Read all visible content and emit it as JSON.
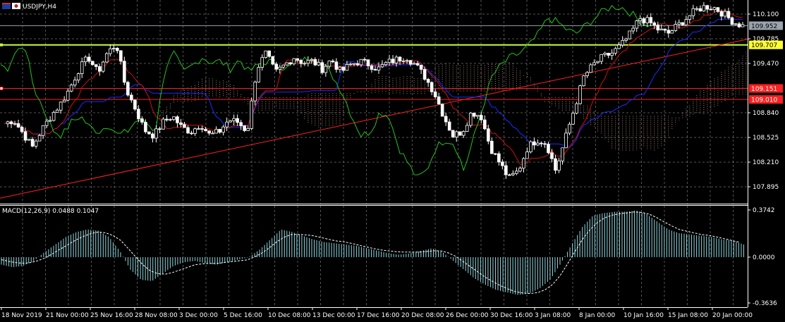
{
  "window": {
    "symbol_title": "USDJPY,H4"
  },
  "colors": {
    "background": "#000000",
    "grid": "#9a9a9a",
    "candle_up": "#ffffff",
    "candle_down": "#ffffff",
    "kijun": "#1a2cff",
    "tenkan": "#d01010",
    "chikou": "#22c41b",
    "cloud_hatch": "#d8a890",
    "hline_red": "#ff1e1e",
    "hline_yellow": "#c6ff3a",
    "trend_red": "#ff2020",
    "macd_hist": "#8fd8e0",
    "macd_signal": "#ffffff",
    "label_yellow_bg": "#ffff33",
    "label_red_bg": "#ff2020",
    "label_gray_bg": "#9aa4ae"
  },
  "chart_data": {
    "type": "candlestick",
    "title": "USDJPY,H4",
    "price_axis_ticks": [
      "110.100",
      "109.785",
      "109.470",
      "108.840",
      "108.525",
      "108.210",
      "107.895"
    ],
    "price_labels": [
      {
        "value": "109.952",
        "color": "gray"
      },
      {
        "value": "109.707",
        "color": "yellow"
      },
      {
        "value": "109.151",
        "color": "red"
      },
      {
        "value": "109.010",
        "color": "red"
      }
    ],
    "horizontal_lines": [
      {
        "price": 109.707,
        "color": "yellow"
      },
      {
        "price": 109.151,
        "color": "red"
      },
      {
        "price": 109.01,
        "color": "red"
      },
      {
        "price": 109.952,
        "color": "gray"
      }
    ],
    "trendline": {
      "from": {
        "time": "18 Nov 2019",
        "price": 107.75
      },
      "to": {
        "time": "20 Jan 16:00",
        "price": 109.78
      },
      "color": "red"
    },
    "time_axis_ticks": [
      "18 Nov 2019",
      "21 Nov 00:00",
      "25 Nov 16:00",
      "28 Nov 08:00",
      "3 Dec 00:00",
      "5 Dec 16:00",
      "10 Dec 08:00",
      "13 Dec 00:00",
      "17 Dec 16:00",
      "20 Dec 08:00",
      "26 Dec 00:00",
      "30 Dec 16:00",
      "3 Jan 08:00",
      "8 Jan 00:00",
      "10 Jan 16:00",
      "15 Jan 08:00",
      "20 Jan 00:00"
    ],
    "close_path": [
      108.7,
      108.75,
      108.58,
      108.4,
      108.62,
      108.8,
      108.95,
      109.15,
      109.4,
      109.55,
      109.35,
      109.6,
      109.72,
      109.15,
      108.9,
      108.62,
      108.55,
      108.72,
      108.8,
      108.65,
      108.6,
      108.7,
      108.55,
      108.6,
      108.75,
      108.72,
      108.6,
      109.4,
      109.6,
      109.35,
      109.45,
      109.55,
      109.48,
      109.5,
      109.4,
      109.52,
      109.36,
      109.45,
      109.5,
      109.46,
      109.4,
      109.48,
      109.52,
      109.56,
      109.45,
      109.3,
      109.1,
      108.8,
      108.55,
      108.6,
      108.85,
      108.8,
      108.4,
      108.2,
      108.0,
      108.1,
      108.4,
      108.5,
      108.45,
      108.1,
      108.5,
      108.9,
      109.3,
      109.45,
      109.55,
      109.6,
      109.7,
      109.85,
      110.05,
      110.0,
      109.9,
      109.85,
      109.95,
      110.05,
      110.15,
      110.2,
      110.18,
      110.1,
      110.0,
      109.95
    ],
    "indicator": {
      "name": "MACD(12,26,9)",
      "params_label": "MACD(12,26,9) 0.0488 0.1047",
      "main": 0.0488,
      "signal": 0.1047,
      "axis_ticks": [
        "0.3742",
        "0.0000",
        "-0.3636"
      ],
      "ylim": [
        -0.3636,
        0.3742
      ],
      "histogram": [
        -0.06,
        -0.08,
        -0.07,
        -0.03,
        0.04,
        0.1,
        0.16,
        0.2,
        0.22,
        0.21,
        0.16,
        0.05,
        -0.1,
        -0.18,
        -0.19,
        -0.13,
        -0.07,
        -0.04,
        -0.03,
        -0.05,
        -0.06,
        -0.04,
        -0.02,
        0.0,
        0.06,
        0.14,
        0.22,
        0.2,
        0.17,
        0.14,
        0.12,
        0.11,
        0.1,
        0.09,
        0.07,
        0.05,
        0.03,
        0.02,
        0.03,
        0.05,
        0.07,
        0.04,
        -0.03,
        -0.1,
        -0.17,
        -0.22,
        -0.26,
        -0.28,
        -0.3,
        -0.29,
        -0.25,
        -0.18,
        -0.05,
        0.1,
        0.24,
        0.33,
        0.35,
        0.36,
        0.36,
        0.37,
        0.34,
        0.28,
        0.22,
        0.19,
        0.18,
        0.17,
        0.16,
        0.14,
        0.13,
        0.1
      ],
      "signal_path": [
        -0.02,
        -0.04,
        -0.05,
        -0.04,
        -0.01,
        0.04,
        0.09,
        0.14,
        0.18,
        0.2,
        0.19,
        0.14,
        0.05,
        -0.05,
        -0.12,
        -0.14,
        -0.12,
        -0.09,
        -0.06,
        -0.05,
        -0.05,
        -0.04,
        -0.03,
        -0.02,
        0.02,
        0.08,
        0.15,
        0.18,
        0.18,
        0.17,
        0.15,
        0.13,
        0.12,
        0.1,
        0.08,
        0.06,
        0.05,
        0.04,
        0.04,
        0.04,
        0.05,
        0.05,
        0.02,
        -0.04,
        -0.1,
        -0.16,
        -0.21,
        -0.25,
        -0.28,
        -0.29,
        -0.28,
        -0.24,
        -0.14,
        0.0,
        0.14,
        0.25,
        0.31,
        0.34,
        0.35,
        0.36,
        0.35,
        0.31,
        0.26,
        0.22,
        0.2,
        0.18,
        0.17,
        0.15,
        0.13,
        0.11
      ]
    }
  }
}
